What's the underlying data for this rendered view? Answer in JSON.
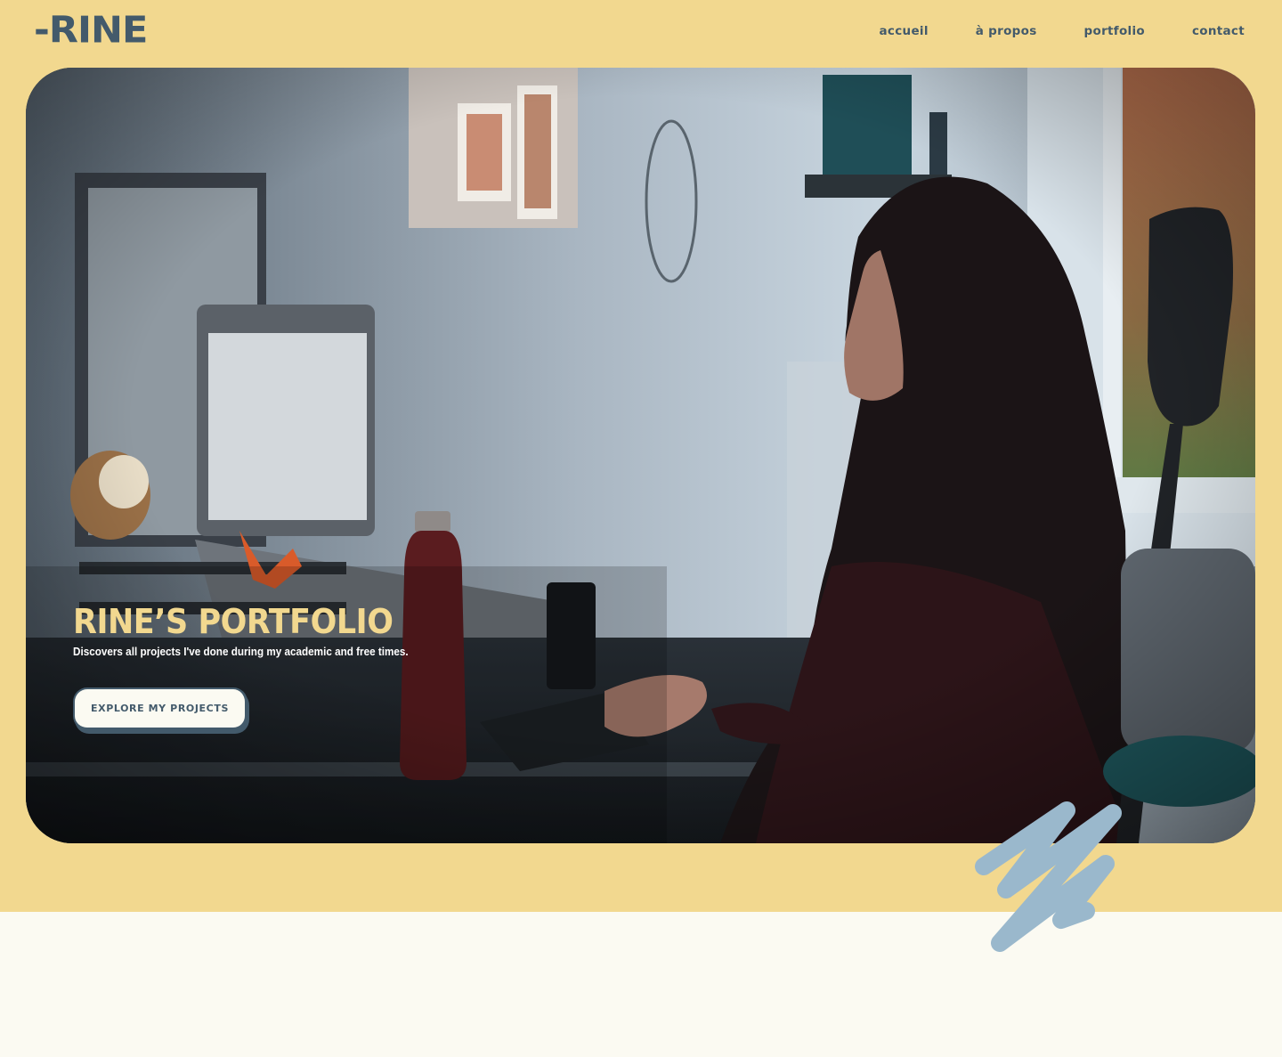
{
  "header": {
    "logo": "-RINE",
    "nav": [
      {
        "label": "accueil"
      },
      {
        "label": "à propos"
      },
      {
        "label": "portfolio"
      },
      {
        "label": "contact"
      }
    ]
  },
  "hero": {
    "title": "RINE’S PORTFOLIO",
    "subtitle": "Discovers all projects I've done during my academic and free times.",
    "cta_label": "EXPLORE MY PROJECTS",
    "image_alt": "woman-typing-at-desk-photo"
  },
  "colors": {
    "yellow": "#f2d88f",
    "slate": "#435a6b",
    "cream": "#fbfaf2",
    "scribble_blue": "#9ab8cc"
  }
}
